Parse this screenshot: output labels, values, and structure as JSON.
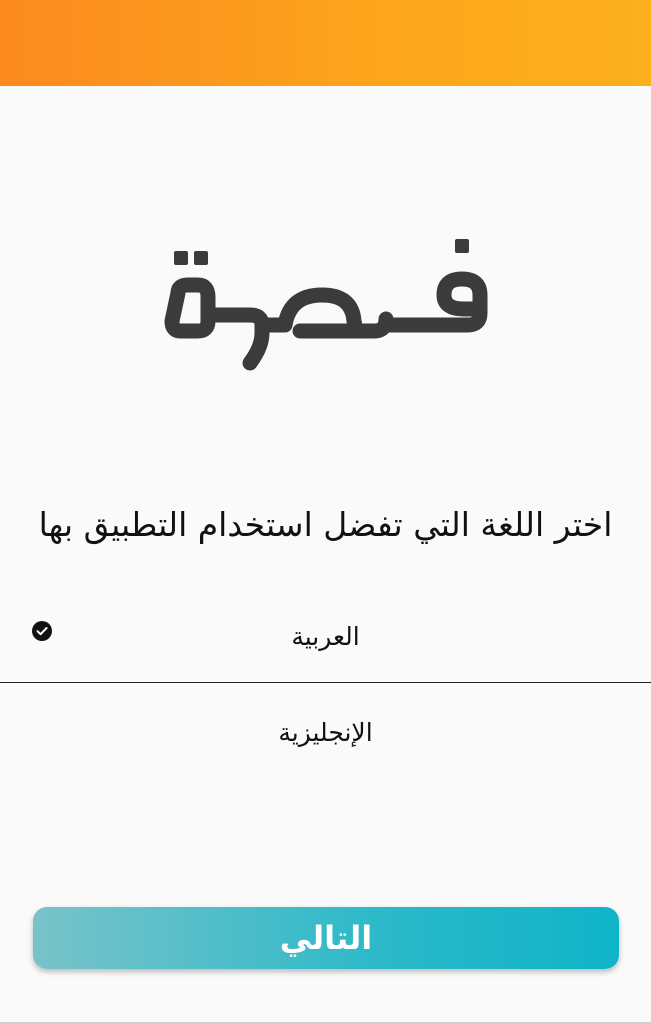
{
  "status_bar": {
    "gradient_start": "#fb8a1f",
    "gradient_end": "#fcb01c"
  },
  "logo": {
    "text": "فرصة",
    "color": "#3b3b3b"
  },
  "prompt": {
    "text": "اختر اللغة التي تفضل استخدام التطبيق بها"
  },
  "languages": [
    {
      "label": "العربية",
      "selected": true
    },
    {
      "label": "الإنجليزية",
      "selected": false
    }
  ],
  "icons": {
    "selected_check": "check-circle-icon"
  },
  "next_button": {
    "label": "التالي",
    "color_start": "#79c3c9",
    "color_end": "#0fb4c8"
  }
}
